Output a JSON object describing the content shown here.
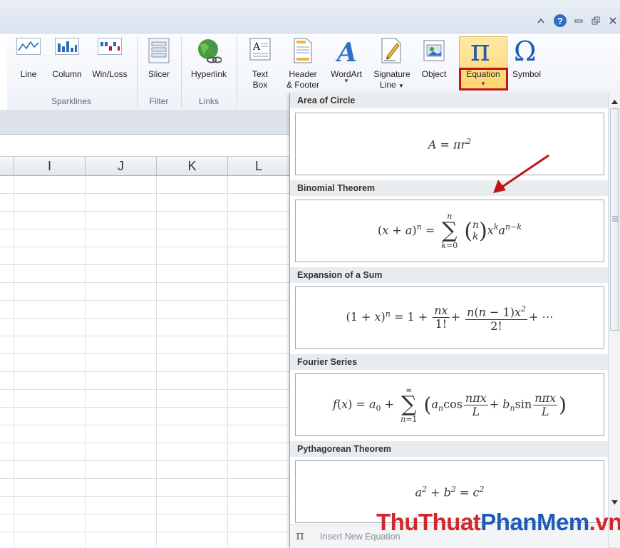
{
  "window": {
    "help": "?"
  },
  "ribbon": {
    "buttons": {
      "line": "Line",
      "column": "Column",
      "winloss": "Win/Loss",
      "slicer": "Slicer",
      "hyperlink": "Hyperlink",
      "textbox_1": "Text",
      "textbox_2": "Box",
      "header_1": "Header",
      "header_2": "& Footer",
      "wordart": "WordArt",
      "signature_1": "Signature",
      "signature_2": "Line",
      "object": "Object",
      "equation": "Equation",
      "symbol": "Symbol"
    },
    "groups": {
      "sparklines": "Sparklines",
      "filter": "Filter",
      "links": "Links"
    }
  },
  "sheet": {
    "columns": [
      "I",
      "J",
      "K",
      "L"
    ]
  },
  "gallery": {
    "items": [
      {
        "title": "Area of Circle"
      },
      {
        "title": "Binomial Theorem"
      },
      {
        "title": "Expansion of a Sum"
      },
      {
        "title": "Fourier Series"
      },
      {
        "title": "Pythagorean Theorem"
      }
    ],
    "insert_new": "Insert New Equation"
  },
  "watermark": {
    "part1": "ThuThuat",
    "part2": "PhanMem",
    "part3": ".vn"
  },
  "colors": {
    "highlight_border": "#c0141b",
    "arrow": "#c0141b",
    "accent_blue": "#1f5bb5"
  }
}
